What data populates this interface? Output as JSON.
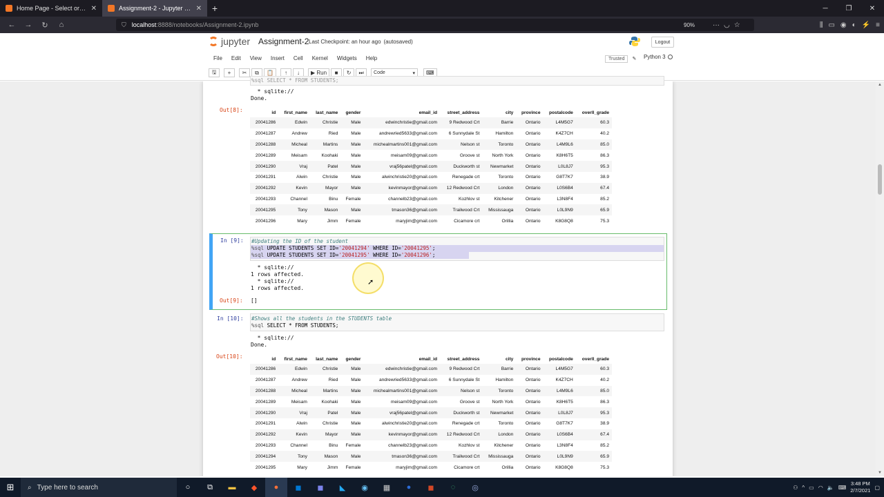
{
  "browser": {
    "tabs": [
      {
        "label": "Home Page - Select or create a",
        "active": false
      },
      {
        "label": "Assignment-2 - Jupyter Notebo",
        "active": true
      }
    ],
    "url_host": "localhost",
    "url_path": ":8888/notebooks/Assignment-2.ipynb",
    "zoom": "90%"
  },
  "jupyter": {
    "logo_text": "jupyter",
    "notebook_name": "Assignment-2",
    "checkpoint": "Last Checkpoint: an hour ago",
    "autosaved": "(autosaved)",
    "logout": "Logout",
    "menu": [
      "File",
      "Edit",
      "View",
      "Insert",
      "Cell",
      "Kernel",
      "Widgets",
      "Help"
    ],
    "trusted": "Trusted",
    "kernel": "Python 3",
    "run_label": "Run",
    "cell_type": "Code"
  },
  "cells": {
    "top_sql_fragment": "%sql SELECT * FROM STUDENTS;",
    "c8_out_lines": "  * sqlite://\nDone.",
    "c8_out_prompt": "Out[8]:",
    "c9_in_prompt": "In [9]:",
    "c9_comment": "#Updating the ID of the student",
    "c9_line1_a": "%sql",
    "c9_line1_b": " UPDATE STUDENTS SET ID=",
    "c9_line1_c": "'20041294'",
    "c9_line1_d": " WHERE ID=",
    "c9_line1_e": "'20041295'",
    "c9_line1_f": ";",
    "c9_line2_a": "%sql",
    "c9_line2_b": " UPDATE STUDENTS SET ID=",
    "c9_line2_c": "'20041295'",
    "c9_line2_d": " WHERE ID=",
    "c9_line2_e": "'20041296'",
    "c9_line2_f": ";",
    "c9_out_lines": "  * sqlite://\n1 rows affected.\n  * sqlite://\n1 rows affected.",
    "c9_out_prompt": "Out[9]:",
    "c9_out_value": "[]",
    "c10_in_prompt": "In [10]:",
    "c10_comment": "#Shows all the students in the STUDENTS table",
    "c10_line_a": "%sql",
    "c10_line_b": " SELECT * FROM STUDENTS;",
    "c10_out_lines": "  * sqlite://\nDone.",
    "c10_out_prompt": "Out[10]:"
  },
  "table_headers": [
    "id",
    "first_name",
    "last_name",
    "gender",
    "email_id",
    "street_address",
    "city",
    "province",
    "postalcode",
    "overll_grade"
  ],
  "table1_rows": [
    [
      "20041286",
      "Edwin",
      "Christie",
      "Male",
      "edwinchristie@gmail.com",
      "9 Redwood Crt",
      "Barrie",
      "Ontario",
      "L4M5G7",
      "60.3"
    ],
    [
      "20041287",
      "Andrew",
      "Ried",
      "Male",
      "andrewried5633@gmail.com",
      "6 Sunnydale St",
      "Hamilton",
      "Ontario",
      "K4Z7CH",
      "40.2"
    ],
    [
      "20041288",
      "Micheal",
      "Martins",
      "Male",
      "michealmartins001@gmail.com",
      "Nelson st",
      "Toronto",
      "Ontario",
      "L4M9L6",
      "85.0"
    ],
    [
      "20041289",
      "Meisam",
      "Koohaki",
      "Male",
      "meisam09@gmail.com",
      "Groove st",
      "North York",
      "Ontario",
      "K8H6T5",
      "86.3"
    ],
    [
      "20041290",
      "Vraj",
      "Patel",
      "Male",
      "vraj56patel@gmail.com",
      "Duckworth st",
      "Newmarket",
      "Ontario",
      "L0L8J7",
      "95.3"
    ],
    [
      "20041291",
      "Alwin",
      "Christie",
      "Male",
      "alwinchristie20@gmail.com",
      "Renegade crt",
      "Toronto",
      "Ontario",
      "G8T7K7",
      "38.9"
    ],
    [
      "20041292",
      "Kevin",
      "Mayor",
      "Male",
      "kevinmayor@gmail.com",
      "12 Redwood Crt",
      "London",
      "Ontario",
      "L0S6B4",
      "67.4"
    ],
    [
      "20041293",
      "Channel",
      "Binu",
      "Female",
      "channelb23@gmail.com",
      "Kozhlov st",
      "Kitchener",
      "Ontario",
      "L3N8F4",
      "85.2"
    ],
    [
      "20041295",
      "Tony",
      "Mason",
      "Male",
      "tmason36@gmail.com",
      "Trailwood Crt",
      "Mississauga",
      "Ontario",
      "L0L9N9",
      "65.9"
    ],
    [
      "20041296",
      "Mary",
      "Jimm",
      "Female",
      "maryjim@gmail.com",
      "Cicamore crt",
      "Orillia",
      "Ontario",
      "K8G8Q8",
      "75.3"
    ]
  ],
  "table2_rows": [
    [
      "20041286",
      "Edwin",
      "Christie",
      "Male",
      "edwinchristie@gmail.com",
      "9 Redwood Crt",
      "Barrie",
      "Ontario",
      "L4M5G7",
      "60.3"
    ],
    [
      "20041287",
      "Andrew",
      "Ried",
      "Male",
      "andrewried5633@gmail.com",
      "6 Sunnydale St",
      "Hamilton",
      "Ontario",
      "K4Z7CH",
      "40.2"
    ],
    [
      "20041288",
      "Micheal",
      "Martins",
      "Male",
      "michealmartins001@gmail.com",
      "Nelson st",
      "Toronto",
      "Ontario",
      "L4M9L6",
      "85.0"
    ],
    [
      "20041289",
      "Meisam",
      "Koohaki",
      "Male",
      "meisam09@gmail.com",
      "Groove st",
      "North York",
      "Ontario",
      "K8H6T5",
      "86.3"
    ],
    [
      "20041290",
      "Vraj",
      "Patel",
      "Male",
      "vraj56patel@gmail.com",
      "Duckworth st",
      "Newmarket",
      "Ontario",
      "L0L8J7",
      "95.3"
    ],
    [
      "20041291",
      "Alwin",
      "Christie",
      "Male",
      "alwinchristie20@gmail.com",
      "Renegade crt",
      "Toronto",
      "Ontario",
      "G8T7K7",
      "38.9"
    ],
    [
      "20041292",
      "Kevin",
      "Mayor",
      "Male",
      "kevinmayor@gmail.com",
      "12 Redwood Crt",
      "London",
      "Ontario",
      "L0S6B4",
      "67.4"
    ],
    [
      "20041293",
      "Channel",
      "Binu",
      "Female",
      "channelb23@gmail.com",
      "Kozhlov st",
      "Kitchener",
      "Ontario",
      "L3N8F4",
      "85.2"
    ],
    [
      "20041294",
      "Tony",
      "Mason",
      "Male",
      "tmason36@gmail.com",
      "Trailwood Crt",
      "Mississauga",
      "Ontario",
      "L0L9N9",
      "65.9"
    ],
    [
      "20041295",
      "Mary",
      "Jimm",
      "Female",
      "maryjim@gmail.com",
      "Cicamore crt",
      "Orillia",
      "Ontario",
      "K8G8Q8",
      "75.3"
    ]
  ],
  "taskbar": {
    "search_placeholder": "Type here to search",
    "time": "3:48 PM",
    "date": "2/7/2021"
  },
  "colors": {
    "jupyter_orange": "#f37726",
    "selected_cell_border": "#66bb6a",
    "in_prompt": "#303f9f",
    "out_prompt": "#d84315"
  }
}
